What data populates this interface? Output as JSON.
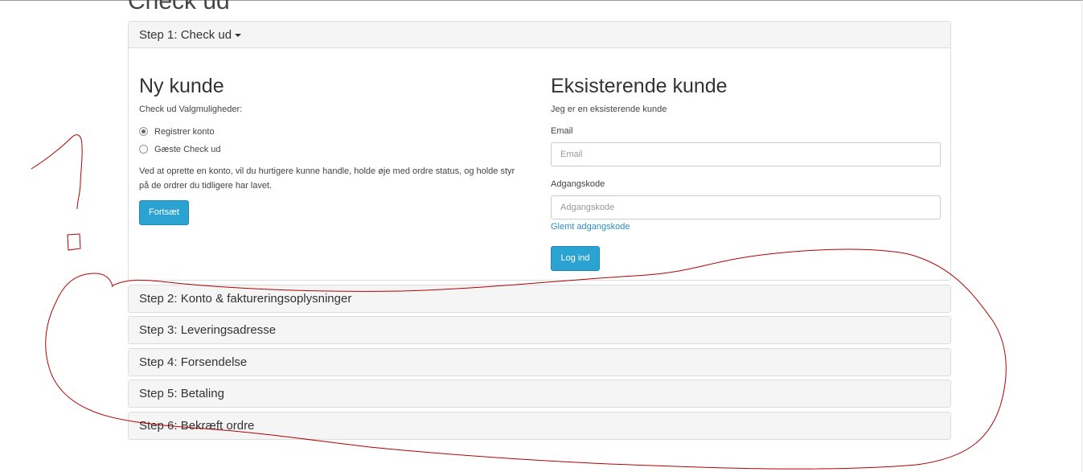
{
  "page": {
    "title": "Check ud"
  },
  "step1": {
    "heading": "Step 1: Check ud",
    "new_customer": {
      "title": "Ny kunde",
      "options_label": "Check ud Valgmuligheder:",
      "options": [
        {
          "label": "Registrer konto",
          "checked": true
        },
        {
          "label": "Gæste Check ud",
          "checked": false
        }
      ],
      "description": "Ved at oprette en konto, vil du hurtigere kunne handle, holde øje med ordre status, og holde styr på de ordrer du tidligere har lavet.",
      "continue_button": "Fortsæt"
    },
    "existing_customer": {
      "title": "Eksisterende kunde",
      "subtitle": "Jeg er en eksisterende kunde",
      "email_label": "Email",
      "email_placeholder": "Email",
      "password_label": "Adgangskode",
      "password_placeholder": "Adgangskode",
      "forgot_link": "Glemt adgangskode",
      "login_button": "Log ind"
    }
  },
  "steps": [
    "Step 2: Konto & faktureringsoplysninger",
    "Step 3: Leveringsadresse",
    "Step 4: Forsendelse",
    "Step 5: Betaling",
    "Step 6: Bekræft ordre"
  ],
  "colors": {
    "primary_button": "#2aa3d2",
    "link": "#2a8fc7",
    "annotation": "#b30000"
  }
}
